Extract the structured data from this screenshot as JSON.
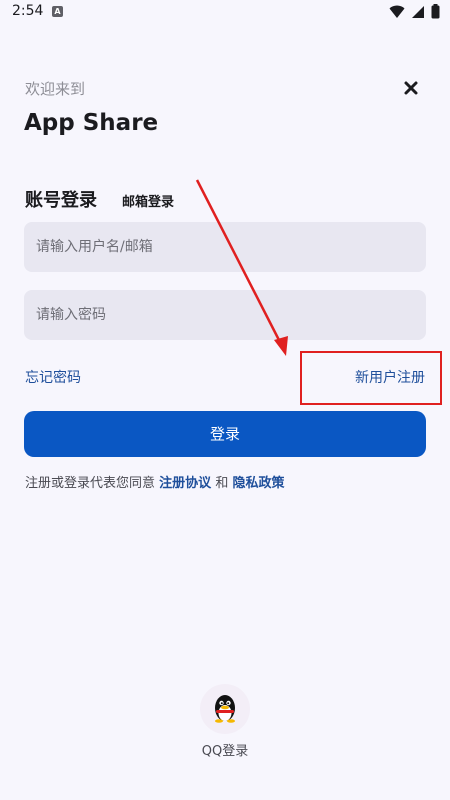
{
  "status_bar": {
    "time": "2:54",
    "notification_icon": "A"
  },
  "header": {
    "welcome": "欢迎来到",
    "app_name": "App Share",
    "close_icon": "close-icon"
  },
  "tabs": {
    "account": "账号登录",
    "email": "邮箱登录"
  },
  "form": {
    "username_placeholder": "请输入用户名/邮箱",
    "password_placeholder": "请输入密码"
  },
  "links": {
    "forgot": "忘记密码",
    "register": "新用户注册"
  },
  "login_button": "登录",
  "agreement": {
    "prefix": "注册或登录代表您同意",
    "terms": "注册协议",
    "and": "和",
    "privacy": "隐私政策"
  },
  "qq": {
    "label": "QQ登录",
    "icon": "qq-penguin-icon"
  },
  "colors": {
    "accent": "#0a57c3",
    "link": "#1f4f9b",
    "annotation": "#e02020",
    "background": "#f7f6fd",
    "field": "#e8e7f1"
  }
}
